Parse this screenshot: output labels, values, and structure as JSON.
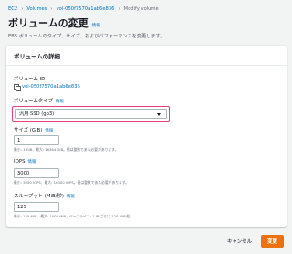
{
  "breadcrumb": {
    "items": [
      "EC2",
      "Volumes",
      "vol-050f7570a1ab6e836",
      "Modify volume"
    ],
    "separator": "›"
  },
  "header": {
    "title": "ボリュームの変更",
    "info": "情報",
    "description": "EBS ボリュームのタイプ、サイズ、およびパフォーマンスを変更します。"
  },
  "panel": {
    "title": "ボリュームの詳細",
    "volume_id": {
      "label": "ボリューム ID",
      "value": "vol-050f7570a1ab6e836"
    },
    "volume_type": {
      "label": "ボリュームタイプ",
      "info": "情報",
      "selected": "汎用 SSD (gp3)"
    },
    "size": {
      "label": "サイズ (GiB)",
      "info": "情報",
      "value": "1",
      "hint": "最小: 1 GiB、最大: 16384 GiB。値は整数である必要があります。"
    },
    "iops": {
      "label": "IOPS",
      "info": "情報",
      "value": "3000",
      "hint": "最小: 3000 IOPS、最大: 16000 IOPS。値は整数である必要があります。"
    },
    "throughput": {
      "label": "スループット (MiB/秒)",
      "info": "情報",
      "value": "125",
      "hint": "最小: 125 MiB、最大: 1000 MiB。ベースライン: 1 IB ごとに 120 MiB/秒。"
    }
  },
  "actions": {
    "cancel": "キャンセル",
    "submit": "変更"
  },
  "colors": {
    "accent_link": "#0073bb",
    "primary_button": "#ec7211",
    "highlight_border": "#e8417e"
  }
}
